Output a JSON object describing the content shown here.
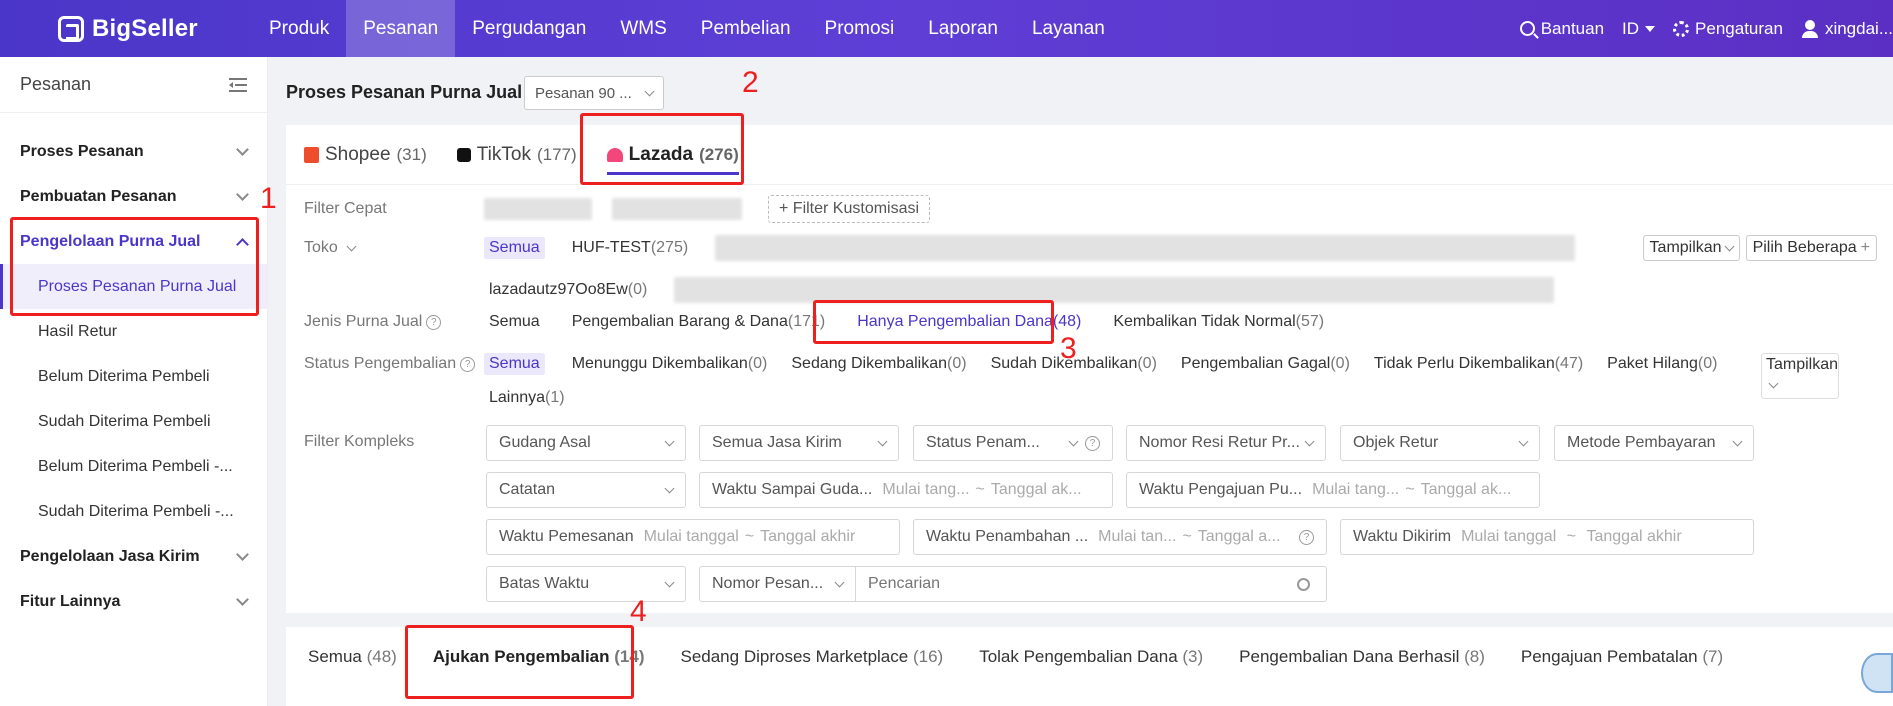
{
  "topbar": {
    "brand": "BigSeller",
    "nav": [
      "Produk",
      "Pesanan",
      "Pergudangan",
      "WMS",
      "Pembelian",
      "Promosi",
      "Laporan",
      "Layanan"
    ],
    "help": "Bantuan",
    "lang": "ID",
    "settings": "Pengaturan",
    "user": "xingdai..."
  },
  "sidebar": {
    "title": "Pesanan",
    "groups": [
      "Proses Pesanan",
      "Pembuatan Pesanan",
      "Pengelolaan Purna Jual",
      "Pengelolaan Jasa Kirim",
      "Fitur Lainnya"
    ],
    "subitems": [
      "Proses Pesanan Purna Jual",
      "Hasil Retur",
      "Belum Diterima Pembeli",
      "Sudah Diterima Pembeli",
      "Belum Diterima Pembeli -...",
      "Sudah Diterima Pembeli -..."
    ]
  },
  "main": {
    "title": "Proses Pesanan Purna Jual",
    "range_select": "Pesanan 90 ...",
    "platform_tabs": [
      {
        "label": "Shopee",
        "count": "(31)"
      },
      {
        "label": "TikTok",
        "count": "(177)"
      },
      {
        "label": "Lazada",
        "count": "(276)"
      }
    ],
    "filters": {
      "quick_label": "Filter Cepat",
      "custom_filter": "Filter Kustomisasi",
      "store_label": "Toko",
      "store_all": "Semua",
      "store_1": "HUF-TEST",
      "store_1_count": "(275)",
      "store_2": "lazadautz97Oo8Ew",
      "store_2_count": "(0)",
      "show": "Tampilkan",
      "pick_many": "Pilih Beberapa",
      "type_label": "Jenis Purna Jual",
      "type_opts": [
        {
          "label": "Semua",
          "count": ""
        },
        {
          "label": "Pengembalian Barang & Dana",
          "count": "(171)"
        },
        {
          "label": "Hanya Pengembalian Dana",
          "count": "(48)"
        },
        {
          "label": "Kembalikan Tidak Normal",
          "count": "(57)"
        }
      ],
      "status_label": "Status Pengembalian",
      "status_opts": [
        {
          "label": "Semua",
          "count": ""
        },
        {
          "label": "Menunggu Dikembalikan",
          "count": "(0)"
        },
        {
          "label": "Sedang Dikembalikan",
          "count": "(0)"
        },
        {
          "label": "Sudah Dikembalikan",
          "count": "(0)"
        },
        {
          "label": "Pengembalian Gagal",
          "count": "(0)"
        },
        {
          "label": "Tidak Perlu Dikembalikan",
          "count": "(47)"
        },
        {
          "label": "Paket Hilang",
          "count": "(0)"
        }
      ],
      "status_other": "Lainnya",
      "status_other_count": "(1)",
      "complex_label": "Filter Kompleks",
      "gudang": "Gudang Asal",
      "jasa": "Semua Jasa Kirim",
      "status_penam": "Status Penam...",
      "resi": "Nomor Resi Retur Pr...",
      "objek": "Objek Retur",
      "metode": "Metode Pembayaran",
      "catatan": "Catatan",
      "waktu_sampai": "Waktu Sampai Guda...",
      "waktu_sampai_start": "Mulai tang...",
      "waktu_sampai_end": "Tanggal ak...",
      "waktu_pengajuan": "Waktu Pengajuan Pu...",
      "waktu_pengajuan_start": "Mulai tang...",
      "waktu_pengajuan_end": "Tanggal ak...",
      "waktu_pemesanan": "Waktu Pemesanan",
      "waktu_pemesanan_start": "Mulai tanggal",
      "waktu_pemesanan_end": "Tanggal akhir",
      "waktu_penambahan": "Waktu Penambahan ...",
      "waktu_penambahan_start": "Mulai tan...",
      "waktu_penambahan_end": "Tanggal a...",
      "waktu_dikirim": "Waktu Dikirim",
      "waktu_dikirim_start": "Mulai tanggal",
      "waktu_dikirim_end": "Tanggal akhir",
      "batas": "Batas Waktu",
      "nomor_pesanan": "Nomor Pesan...",
      "search_placeholder": "Pencarian"
    },
    "status_tabs": [
      {
        "label": "Semua",
        "count": "(48)"
      },
      {
        "label": "Ajukan Pengembalian",
        "count": "(14)"
      },
      {
        "label": "Sedang Diproses Marketplace",
        "count": "(16)"
      },
      {
        "label": "Tolak Pengembalian Dana",
        "count": "(3)"
      },
      {
        "label": "Pengembalian Dana Berhasil",
        "count": "(8)"
      },
      {
        "label": "Pengajuan Pembatalan",
        "count": "(7)"
      }
    ]
  },
  "annotations": [
    "1",
    "2",
    "3",
    "4"
  ],
  "colors": {
    "brand": "#4a36c8",
    "annotation": "#ee1f1f"
  }
}
